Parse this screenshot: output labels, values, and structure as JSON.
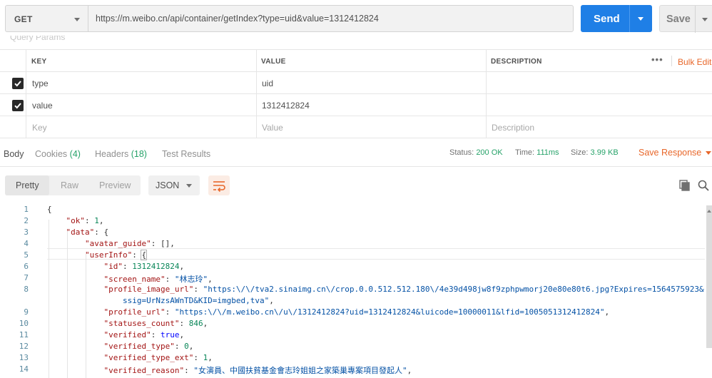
{
  "request": {
    "method": "GET",
    "url": "https://m.weibo.cn/api/container/getIndex?type=uid&value=1312412824",
    "send_label": "Send",
    "save_label": "Save",
    "section_label_cut": "Query Params"
  },
  "params": {
    "headers": {
      "key": "KEY",
      "value": "VALUE",
      "description": "DESCRIPTION"
    },
    "more_label": "•••",
    "bulk_edit_label": "Bulk Edit",
    "rows": [
      {
        "checked": true,
        "key": "type",
        "value": "uid",
        "description": ""
      },
      {
        "checked": true,
        "key": "value",
        "value": "1312412824",
        "description": ""
      }
    ],
    "placeholders": {
      "key": "Key",
      "value": "Value",
      "description": "Description"
    }
  },
  "response": {
    "tabs": [
      {
        "label": "Body",
        "count": ""
      },
      {
        "label": "Cookies",
        "count": "(4)"
      },
      {
        "label": "Headers",
        "count": "(18)"
      },
      {
        "label": "Test Results",
        "count": ""
      }
    ],
    "status_label": "Status:",
    "status_value": "200 OK",
    "time_label": "Time:",
    "time_value": "111ms",
    "size_label": "Size:",
    "size_value": "3.99 KB",
    "save_response_label": "Save Response"
  },
  "view": {
    "modes": [
      "Pretty",
      "Raw",
      "Preview"
    ],
    "active_mode": "Pretty",
    "format": "JSON"
  },
  "code": {
    "line_numbers": [
      "1",
      "2",
      "3",
      "4",
      "5",
      "6",
      "7",
      "8",
      "",
      "9",
      "10",
      "11",
      "12",
      "13",
      "14"
    ],
    "l1": "{",
    "l2k": "\"ok\"",
    "l2v": "1",
    "l3k": "\"data\"",
    "l4k": "\"avatar_guide\"",
    "l4v": "[]",
    "l5k": "\"userInfo\"",
    "l6k": "\"id\"",
    "l6v": "1312412824",
    "l7k": "\"screen_name\"",
    "l7v": "\"林志玲\"",
    "l8k": "\"profile_image_url\"",
    "l8v": "\"https:\\/\\/tva2.sinaimg.cn\\/crop.0.0.512.512.180\\/4e39d498jw8f9zphpwmorj20e80e80t6.jpg?Expires=1564575923&",
    "l8b": "ssig=UrNzsAWnTD&KID=imgbed,tva\"",
    "l9k": "\"profile_url\"",
    "l9v": "\"https:\\/\\/m.weibo.cn\\/u\\/1312412824?uid=1312412824&luicode=10000011&lfid=1005051312412824\"",
    "l10k": "\"statuses_count\"",
    "l10v": "846",
    "l11k": "\"verified\"",
    "l11v": "true",
    "l12k": "\"verified_type\"",
    "l12v": "0",
    "l13k": "\"verified_type_ext\"",
    "l13v": "1",
    "l14k": "\"verified_reason\"",
    "l14v": "\"女演員、中國扶貧基金會志玲姐姐之家築巢專案項目發起人\""
  },
  "colors": {
    "accent_send": "#1f7fe6",
    "accent_orange": "#e8672a",
    "status_green": "#26a269"
  },
  "icons": [
    "checkbox-checked-icon",
    "wrap-lines-icon",
    "copy-icon",
    "search-icon",
    "chevron-down-icon"
  ]
}
